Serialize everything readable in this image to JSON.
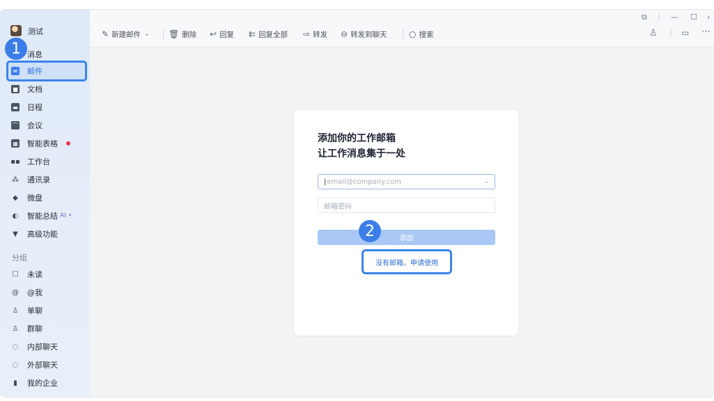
{
  "user": {
    "name": "测试"
  },
  "sidebar": {
    "items": [
      {
        "label": "消息",
        "icon": "chat-icon"
      },
      {
        "label": "邮件",
        "icon": "mail-icon"
      },
      {
        "label": "文档",
        "icon": "doc-icon"
      },
      {
        "label": "日程",
        "icon": "calendar-icon"
      },
      {
        "label": "会议",
        "icon": "meeting-icon"
      },
      {
        "label": "智能表格",
        "icon": "table-icon"
      },
      {
        "label": "工作台",
        "icon": "grid-icon"
      },
      {
        "label": "通讯录",
        "icon": "contacts-icon"
      },
      {
        "label": "微盘",
        "icon": "drive-icon"
      },
      {
        "label": "智能总结",
        "icon": "summary-icon",
        "tag": "AI"
      },
      {
        "label": "高级功能",
        "icon": "advanced-icon"
      }
    ],
    "section_label": "分组",
    "groups": [
      {
        "label": "未读",
        "icon": "unread-icon"
      },
      {
        "label": "@我",
        "icon": "at-icon"
      },
      {
        "label": "单聊",
        "icon": "person-icon"
      },
      {
        "label": "群聊",
        "icon": "group-icon"
      },
      {
        "label": "内部聊天",
        "icon": "internal-chat-icon"
      },
      {
        "label": "外部聊天",
        "icon": "external-chat-icon"
      },
      {
        "label": "我的企业",
        "icon": "company-icon"
      }
    ]
  },
  "toolbar": {
    "new_mail": "新建邮件",
    "delete": "删除",
    "reply": "回复",
    "reply_all": "回复全部",
    "forward": "转发",
    "forward_to_chat": "转发到聊天",
    "search": "搜索"
  },
  "card": {
    "title_line1": "添加你的工作邮箱",
    "title_line2": "让工作消息集于一处",
    "email_placeholder": "email@company.com",
    "password_placeholder": "邮箱密码",
    "add_button": "添加",
    "apply_link": "没有邮箱，申请使用"
  },
  "badges": {
    "step1": "1",
    "step2": "2"
  },
  "colors": {
    "accent": "#3b7ee8",
    "active_bg": "#cfe0f7",
    "button_disabled": "#a9c8f5",
    "red_dot": "#e8364a",
    "ai": "#8b63f0"
  }
}
